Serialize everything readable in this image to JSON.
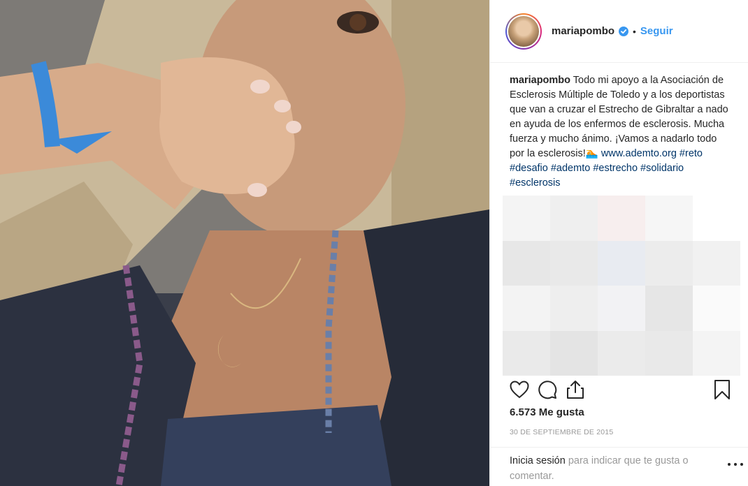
{
  "post": {
    "image_alt": "Selfie photo",
    "header": {
      "username": "mariapombo",
      "separator": "•",
      "follow_label": "Seguir"
    },
    "caption": {
      "username": "mariapombo",
      "text": "Todo mi apoyo a la Asociación de Esclerosis Múltiple de Toledo y a los deportistas que van a cruzar el Estrecho de Gibraltar a nado en ayuda de los enfermos de esclerosis. Mucha fuerza y mucho ánimo. ¡Vamos a nadarlo todo por la esclerosis!🏊",
      "links": [
        "www.ademto.org",
        "#reto",
        "#desafio",
        "#ademto",
        "#estrecho",
        "#solidario",
        "#esclerosis"
      ]
    },
    "actions": {
      "like_icon": "heart-icon",
      "comment_icon": "comment-icon",
      "share_icon": "share-icon",
      "save_icon": "bookmark-icon"
    },
    "likes": "6.573 Me gusta",
    "date": "30 DE SEPTIEMBRE DE 2015",
    "comment_prompt": {
      "login_label": "Inicia sesión",
      "text": " para indicar que te gusta o comentar."
    }
  },
  "colors": {
    "accent": "#3897f0",
    "link": "#003569",
    "muted": "#999999"
  }
}
